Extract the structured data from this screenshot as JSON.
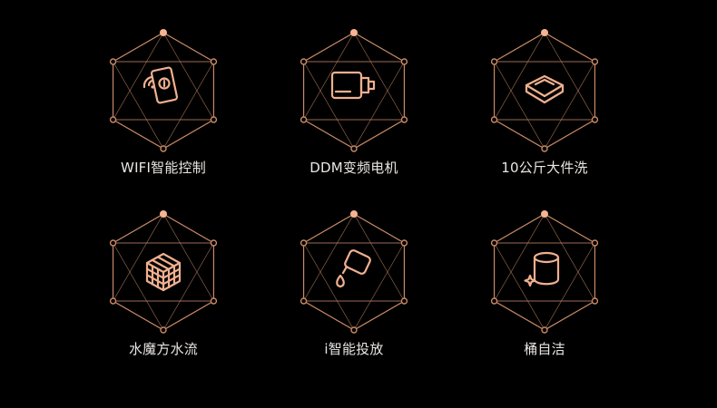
{
  "features": [
    {
      "label": "WIFI智能控制",
      "icon": "smartphone-wifi-icon"
    },
    {
      "label": "DDM变频电机",
      "icon": "motor-icon"
    },
    {
      "label": "10公斤大件洗",
      "icon": "laundry-stack-icon"
    },
    {
      "label": "水魔方水流",
      "icon": "water-cube-icon"
    },
    {
      "label": "i智能投放",
      "icon": "detergent-dispense-icon"
    },
    {
      "label": "桶自洁",
      "icon": "drum-clean-icon"
    }
  ],
  "colors": {
    "background": "#000000",
    "accent": "#c98a66",
    "icon": "#f0b08f",
    "text": "#e9e6e3"
  }
}
